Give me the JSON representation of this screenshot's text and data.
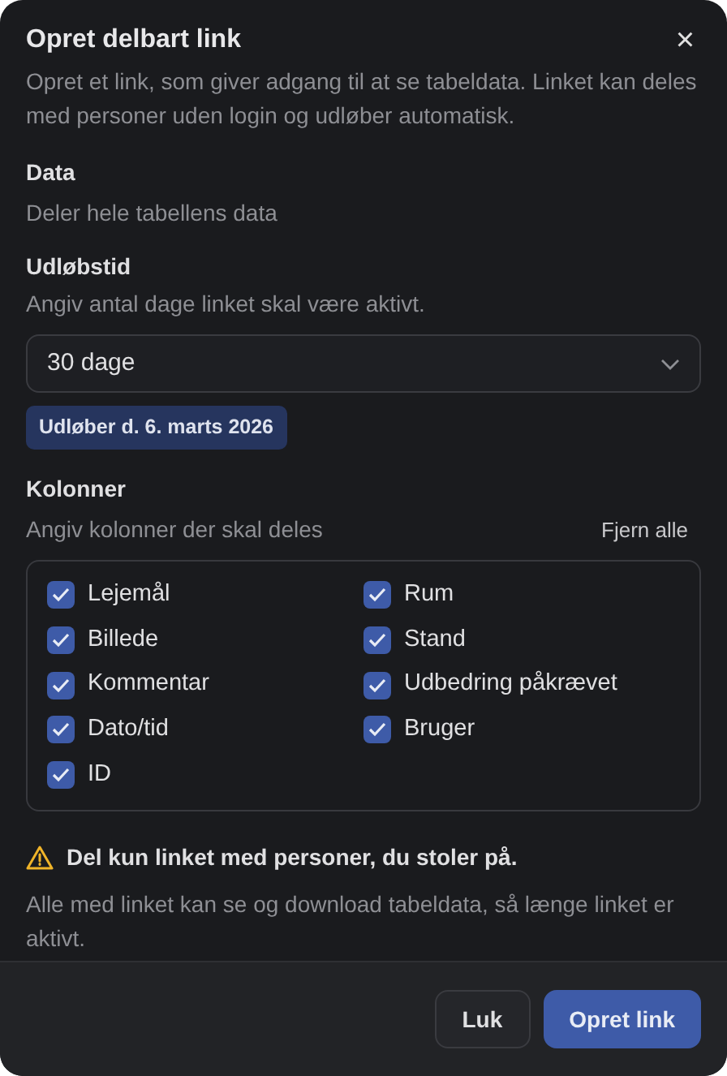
{
  "dialog": {
    "title": "Opret delbart link",
    "close_label": "×",
    "description": "Opret et link, som giver adgang til at se tabeldata. Linket kan deles med personer uden login og udløber automatisk."
  },
  "data_section": {
    "heading": "Data",
    "text": "Deler hele tabellens data"
  },
  "expiry": {
    "heading": "Udløbstid",
    "hint": "Angiv antal dage linket skal være aktivt.",
    "value": "30 dage",
    "badge": "Udløber d. 6. marts 2026"
  },
  "columns_section": {
    "heading": "Kolonner",
    "hint": "Angiv kolonner der skal deles",
    "remove_all": "Fjern alle",
    "columns": [
      {
        "label": "Lejemål",
        "checked": true
      },
      {
        "label": "Rum",
        "checked": true
      },
      {
        "label": "Billede",
        "checked": true
      },
      {
        "label": "Stand",
        "checked": true
      },
      {
        "label": "Kommentar",
        "checked": true
      },
      {
        "label": "Udbedring påkrævet",
        "checked": true
      },
      {
        "label": "Dato/tid",
        "checked": true
      },
      {
        "label": "Bruger",
        "checked": true
      },
      {
        "label": "ID",
        "checked": true
      }
    ]
  },
  "warning": {
    "title": "Del kun linket med personer, du stoler på.",
    "text": "Alle med linket kan se og download tabeldata, så længe linket er aktivt."
  },
  "buttons": [
    {
      "label": "Luk",
      "kind": "secondary"
    },
    {
      "label": "Opret link",
      "kind": "primary"
    }
  ]
}
